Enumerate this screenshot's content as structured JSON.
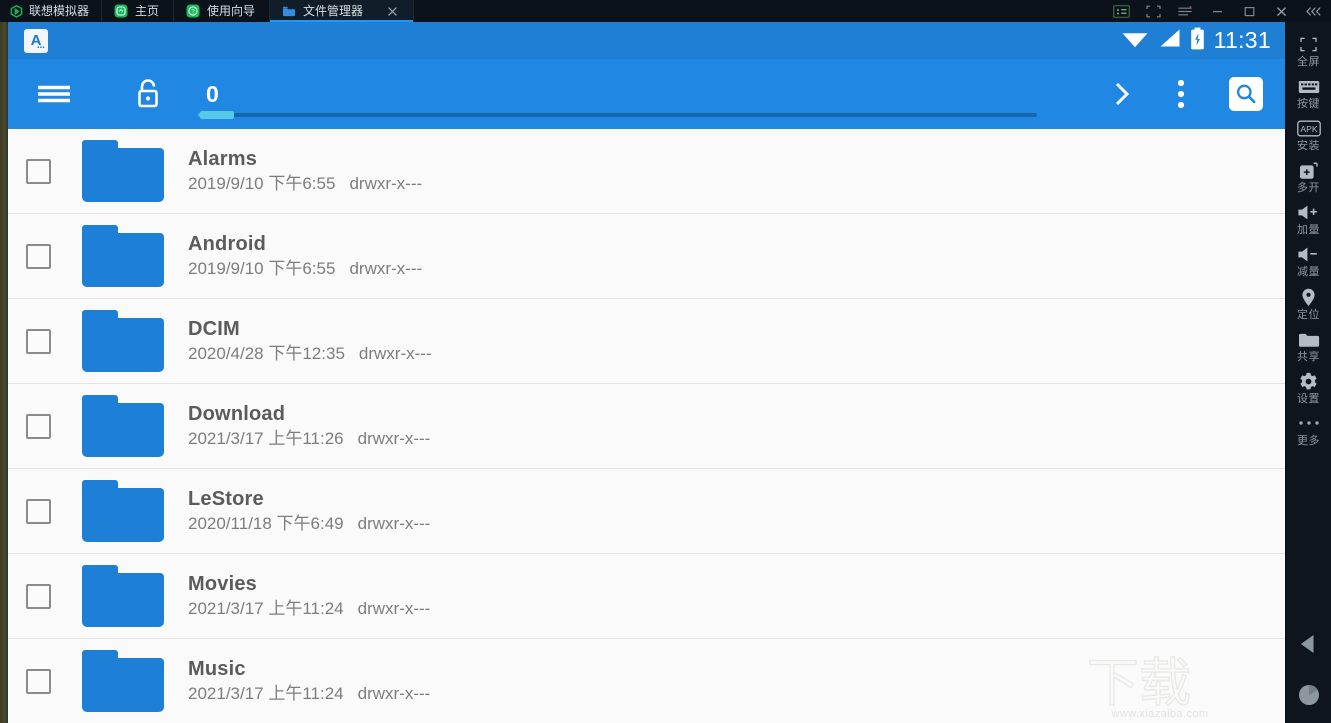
{
  "emulator": {
    "brand": "联想模拟器",
    "tabs": [
      {
        "label": "主页",
        "icon": "home-app-icon",
        "active": false,
        "closable": false
      },
      {
        "label": "使用向导",
        "icon": "help-app-icon",
        "active": false,
        "closable": false
      },
      {
        "label": "文件管理器",
        "icon": "folder-app-icon",
        "active": true,
        "closable": true
      }
    ],
    "window_buttons": [
      {
        "name": "screenshot-button",
        "icon": "screenshot-icon"
      },
      {
        "name": "fullscreen-toggle-button",
        "icon": "crop-frame-icon"
      },
      {
        "name": "menu-button",
        "icon": "hamburger-icon"
      },
      {
        "name": "minimize-button",
        "icon": "minimize-icon"
      },
      {
        "name": "maximize-button",
        "icon": "maximize-icon"
      },
      {
        "name": "close-button",
        "icon": "close-icon"
      },
      {
        "name": "collapse-sidebar-button",
        "icon": "double-chevron-left-icon"
      }
    ]
  },
  "sidebar": {
    "items": [
      {
        "label": "全屏",
        "icon": "fullscreen-icon"
      },
      {
        "label": "按键",
        "icon": "keyboard-icon"
      },
      {
        "label": "安装",
        "icon": "apk-install-icon"
      },
      {
        "label": "多开",
        "icon": "multi-instance-icon"
      },
      {
        "label": "加量",
        "icon": "volume-up-icon"
      },
      {
        "label": "减量",
        "icon": "volume-down-icon"
      },
      {
        "label": "定位",
        "icon": "location-pin-icon"
      },
      {
        "label": "共享",
        "icon": "shared-folder-icon"
      },
      {
        "label": "设置",
        "icon": "gear-icon"
      },
      {
        "label": "更多",
        "icon": "ellipsis-icon"
      }
    ],
    "nav": [
      {
        "name": "android-back-button",
        "icon": "back-triangle-icon"
      },
      {
        "name": "android-home-button",
        "icon": "home-circle-icon"
      }
    ]
  },
  "android": {
    "statusbar": {
      "notification_icon": "app-notification-icon",
      "notification_letter": "A",
      "wifi_icon": "wifi-icon",
      "signal_icon": "cellular-signal-icon",
      "battery_icon": "battery-charging-icon",
      "clock": "11:31"
    },
    "toolbar": {
      "menu_icon": "hamburger-menu-icon",
      "lock_icon": "unlock-icon",
      "count": "0",
      "forward_icon": "chevron-right-icon",
      "overflow_icon": "more-vertical-icon",
      "search_icon": "search-icon",
      "seekbar_value": 2
    },
    "files": [
      {
        "name": "Alarms",
        "date": "2019/9/10 下午6:55",
        "permissions": "drwxr-x---",
        "icon": "folder-icon",
        "checked": false
      },
      {
        "name": "Android",
        "date": "2019/9/10 下午6:55",
        "permissions": "drwxr-x---",
        "icon": "folder-icon",
        "checked": false
      },
      {
        "name": "DCIM",
        "date": "2020/4/28 下午12:35",
        "permissions": "drwxr-x---",
        "icon": "folder-icon",
        "checked": false
      },
      {
        "name": "Download",
        "date": "2021/3/17 上午11:26",
        "permissions": "drwxr-x---",
        "icon": "folder-icon",
        "checked": false
      },
      {
        "name": "LeStore",
        "date": "2020/11/18 下午6:49",
        "permissions": "drwxr-x---",
        "icon": "folder-icon",
        "checked": false
      },
      {
        "name": "Movies",
        "date": "2021/3/17 上午11:24",
        "permissions": "drwxr-x---",
        "icon": "folder-icon",
        "checked": false
      },
      {
        "name": "Music",
        "date": "2021/3/17 上午11:24",
        "permissions": "drwxr-x---",
        "icon": "folder-icon",
        "checked": false
      }
    ]
  },
  "watermark": {
    "logo_text": "下载",
    "url": "www.xiazaiba.com"
  },
  "colors": {
    "titlebar_bg": "#0c1219",
    "sidebar_bg": "#0f151c",
    "status_blue": "#1f7fd4",
    "toolbar_blue": "#2087e2",
    "accent_tab": "#2196f3",
    "folder_blue": "#1e7fd6",
    "list_bg": "#fafafa",
    "name_gray": "#5b5b5b",
    "sub_gray": "#7d7d7d"
  }
}
